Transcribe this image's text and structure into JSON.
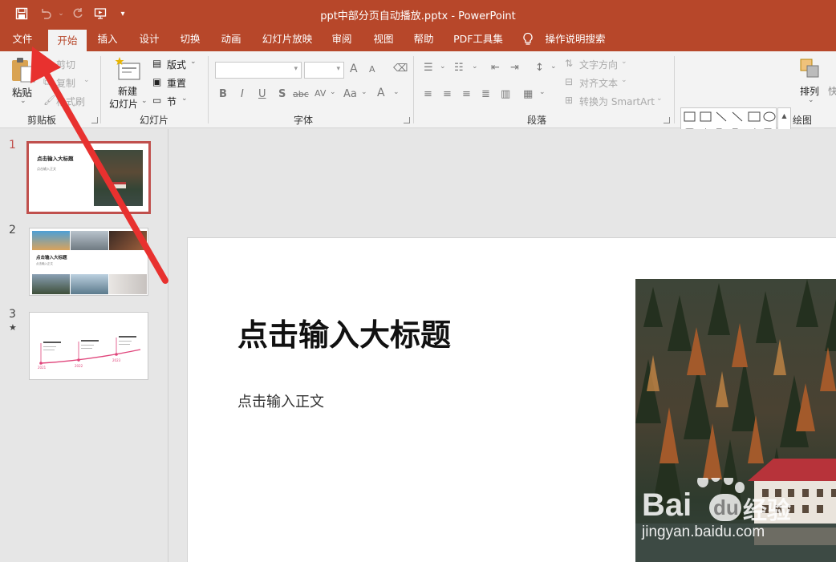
{
  "titlebar": {
    "title": "ppt中部分页自动播放.pptx  -  PowerPoint",
    "qat_icons": [
      "save-icon",
      "undo-icon",
      "redo-icon",
      "start-from-beginning-icon",
      "customize-qat-icon"
    ]
  },
  "tabs": [
    {
      "label": "文件"
    },
    {
      "label": "开始"
    },
    {
      "label": "插入"
    },
    {
      "label": "设计"
    },
    {
      "label": "切换"
    },
    {
      "label": "动画"
    },
    {
      "label": "幻灯片放映"
    },
    {
      "label": "审阅"
    },
    {
      "label": "视图"
    },
    {
      "label": "帮助"
    },
    {
      "label": "PDF工具集"
    },
    {
      "label": "操作说明搜索"
    }
  ],
  "ribbon": {
    "clipboard": {
      "paste": "粘贴",
      "cut": "剪切",
      "copy": "复制",
      "format_painter": "格式刷",
      "group": "剪贴板"
    },
    "slides": {
      "new_slide_line1": "新建",
      "new_slide_line2": "幻灯片",
      "layout": "版式",
      "reset": "重置",
      "section": "节",
      "group": "幻灯片"
    },
    "font": {
      "bold": "B",
      "italic": "I",
      "underline": "U",
      "shadow": "S",
      "strike": "abc",
      "spacing": "AV",
      "case": "Aa",
      "grow": "A",
      "shrink": "A",
      "color": "A",
      "group": "字体"
    },
    "paragraph": {
      "text_direction": "文字方向",
      "align_text": "对齐文本",
      "smartart": "转换为 SmartArt",
      "group": "段落"
    },
    "drawing": {
      "arrange": "排列",
      "quick_styles": "快",
      "group": "绘图"
    }
  },
  "thumbnails": [
    {
      "num": "1",
      "title": "点击输入大标题",
      "body": "点击输入正文"
    },
    {
      "num": "2",
      "title": "点击输入大标题",
      "body": "点击输入正文"
    },
    {
      "num": "3",
      "star": "★",
      "labels": [
        "2021",
        "2022",
        "2023"
      ]
    }
  ],
  "slide": {
    "title": "点击输入大标题",
    "body": "点击输入正文"
  },
  "watermark": {
    "brand": "Bai",
    "brand2": "du",
    "cn": "经验",
    "url": "jingyan.baidu.com"
  },
  "colors": {
    "accent": "#b7472a",
    "selection": "#c0504d",
    "arrow": "#e8312f"
  }
}
